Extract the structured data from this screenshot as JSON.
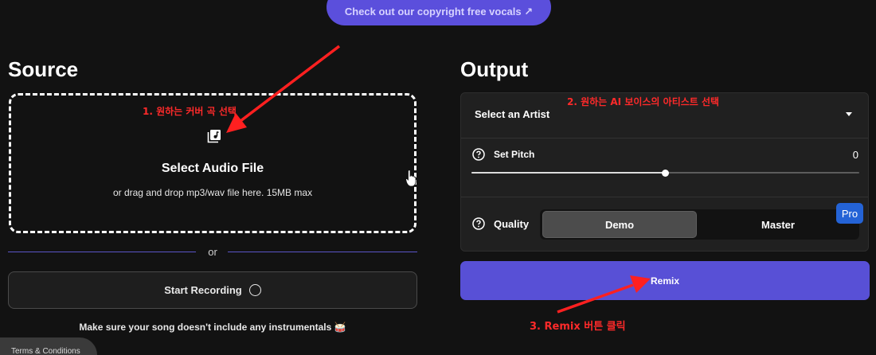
{
  "banner": {
    "label": "Check out our copyright free vocals ↗"
  },
  "source": {
    "title": "Source",
    "dropzone": {
      "icon": "music-library-icon",
      "title": "Select Audio File",
      "subtitle": "or drag and drop mp3/wav file here. 15MB max"
    },
    "divider_text": "or",
    "record_button": {
      "label": "Start Recording",
      "icon": "circle-icon"
    },
    "note": "Make sure your song doesn't include any instrumentals 🥁"
  },
  "output": {
    "title": "Output",
    "artist_select": {
      "value": "Select an Artist",
      "icon": "caret-down-icon"
    },
    "pitch": {
      "label": "Set Pitch",
      "value": "0",
      "level": 0.5
    },
    "quality": {
      "label": "Quality",
      "options": [
        "Demo",
        "Master"
      ],
      "selected": "Demo",
      "pro_badge": "Pro"
    },
    "remix_button": "Remix"
  },
  "annotations": {
    "step1": "1. 원하는 커버 곡 선택",
    "step2": "2. 원하는 AI 보이스의 아티스트 선택",
    "step3": "3. Remix 버튼 클릭"
  },
  "footer": {
    "terms": "Terms & Conditions"
  },
  "colors": {
    "accent": "#5850d6",
    "annotation": "#ff2a2a",
    "pro_badge": "#2463d6"
  }
}
